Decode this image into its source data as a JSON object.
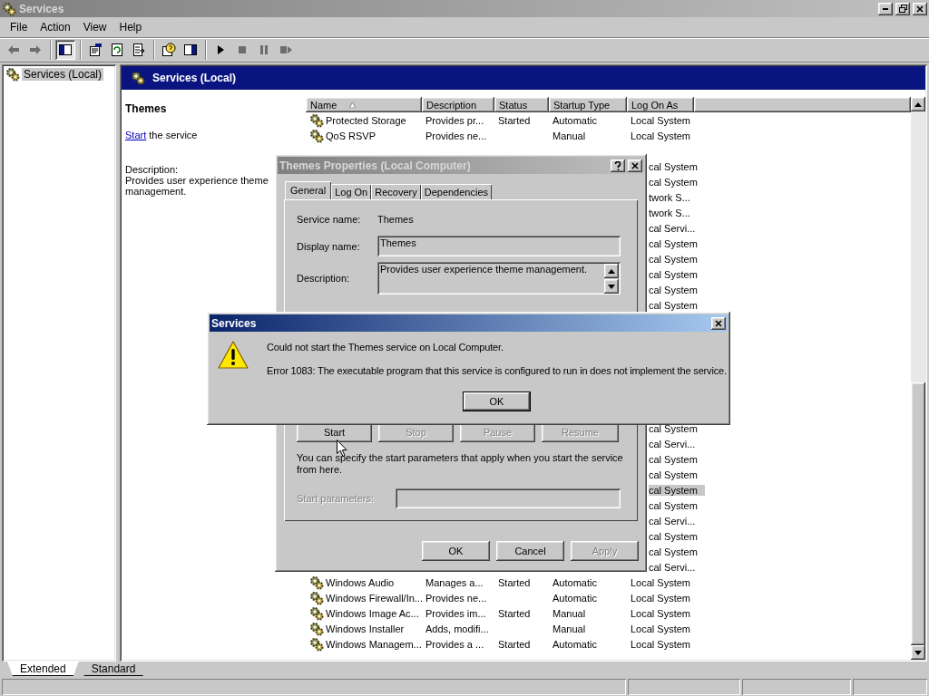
{
  "window": {
    "title": "Services"
  },
  "menu": [
    "File",
    "Action",
    "View",
    "Help"
  ],
  "toolbar": [
    [
      {
        "kind": "back",
        "disabled": true,
        "pressed": false
      },
      {
        "kind": "forward",
        "disabled": true,
        "pressed": false
      }
    ],
    [
      {
        "kind": "tree",
        "disabled": false,
        "pressed": true
      }
    ],
    [
      {
        "kind": "properties",
        "disabled": false,
        "pressed": false
      },
      {
        "kind": "refresh",
        "disabled": false,
        "pressed": false
      },
      {
        "kind": "export",
        "disabled": false,
        "pressed": false
      }
    ],
    [
      {
        "kind": "help",
        "disabled": false,
        "pressed": false
      },
      {
        "kind": "pane",
        "disabled": false,
        "pressed": false
      }
    ],
    [
      {
        "kind": "play",
        "disabled": false,
        "pressed": false
      },
      {
        "kind": "stop",
        "disabled": true,
        "pressed": false
      },
      {
        "kind": "pause",
        "disabled": true,
        "pressed": false
      },
      {
        "kind": "restart",
        "disabled": true,
        "pressed": false
      }
    ]
  ],
  "tree": {
    "items": [
      {
        "label": "Services (Local)",
        "selected": true
      }
    ]
  },
  "header": {
    "title": "Services (Local)"
  },
  "extended_panel": {
    "title": "Themes",
    "start_link": "Start",
    "start_text": "the service",
    "description_label": "Description:",
    "description": "Provides user experience theme management."
  },
  "table": {
    "columns": [
      "Name",
      "Description",
      "Status",
      "Startup Type",
      "Log On As"
    ],
    "rows_top": [
      {
        "name": "Protected Storage",
        "description": "Provides pr...",
        "status": "Started",
        "startup": "Automatic",
        "logon": "Local System",
        "selected": false
      },
      {
        "name": "QoS RSVP",
        "description": "Provides ne...",
        "startup": "Manual",
        "logon": "Local System",
        "selected": false
      }
    ],
    "rows_right_upper": [
      {
        "logon": "cal System",
        "selected": false
      },
      {
        "logon": "cal System",
        "selected": false
      },
      {
        "logon": "twork S...",
        "selected": false
      },
      {
        "logon": "twork S...",
        "selected": false
      },
      {
        "logon": "cal Servi...",
        "selected": false
      },
      {
        "logon": "cal System",
        "selected": false
      },
      {
        "logon": "cal System",
        "selected": false
      },
      {
        "logon": "cal System",
        "selected": false
      },
      {
        "logon": "cal System",
        "selected": false
      },
      {
        "logon": "cal System",
        "selected": false
      }
    ],
    "rows_right_lower": [
      {
        "logon": "cal System",
        "selected": false
      },
      {
        "logon": "cal Servi...",
        "selected": false
      },
      {
        "logon": "cal System",
        "selected": false
      },
      {
        "logon": "cal System",
        "selected": false
      },
      {
        "logon": "cal System",
        "selected": true
      },
      {
        "logon": "cal System",
        "selected": false
      },
      {
        "logon": "cal Servi...",
        "selected": false
      },
      {
        "logon": "cal System",
        "selected": false
      },
      {
        "logon": "cal System",
        "selected": false
      },
      {
        "logon": "cal Servi...",
        "selected": false
      }
    ],
    "rows_bottom": [
      {
        "name": "Windows Audio",
        "description": "Manages a...",
        "status": "Started",
        "startup": "Automatic",
        "logon": "Local System",
        "selected": false
      },
      {
        "name": "Windows Firewall/In...",
        "description": "Provides ne...",
        "startup": "Automatic",
        "logon": "Local System",
        "selected": false
      },
      {
        "name": "Windows Image Ac...",
        "description": "Provides im...",
        "status": "Started",
        "startup": "Manual",
        "logon": "Local System",
        "selected": false
      },
      {
        "name": "Windows Installer",
        "description": "Adds, modifi...",
        "startup": "Manual",
        "logon": "Local System",
        "selected": false
      },
      {
        "name": "Windows Managem...",
        "description": "Provides a ...",
        "status": "Started",
        "startup": "Automatic",
        "logon": "Local System",
        "selected": false
      }
    ]
  },
  "view_tabs": [
    {
      "label": "Extended",
      "selected": true
    },
    {
      "label": "Standard",
      "selected": false
    }
  ],
  "properties_dialog": {
    "title": "Themes Properties (Local Computer)",
    "tabs": [
      {
        "label": "General",
        "selected": true
      },
      {
        "label": "Log On",
        "selected": false
      },
      {
        "label": "Recovery",
        "selected": false
      },
      {
        "label": "Dependencies",
        "selected": false
      }
    ],
    "service_name_label": "Service name:",
    "service_name": "Themes",
    "display_name_label": "Display name:",
    "display_name": "Themes",
    "description_label": "Description:",
    "description": "Provides user experience theme management.",
    "control_buttons": [
      {
        "label": "Start",
        "disabled": false
      },
      {
        "label": "Stop",
        "disabled": true
      },
      {
        "label": "Pause",
        "disabled": true
      },
      {
        "label": "Resume",
        "disabled": true
      }
    ],
    "hint": "You can specify the start parameters that apply when you start the service from here.",
    "start_params_label": "Start parameters:",
    "start_params_disabled": true,
    "buttons": [
      {
        "label": "OK",
        "disabled": false
      },
      {
        "label": "Cancel",
        "disabled": false
      },
      {
        "label": "Apply",
        "disabled": true
      }
    ]
  },
  "message_box": {
    "title": "Services",
    "message": "Could not start the Themes service on Local Computer.",
    "error": "Error 1083: The executable program that this service is configured to run in does not implement the service.",
    "button": "OK"
  }
}
